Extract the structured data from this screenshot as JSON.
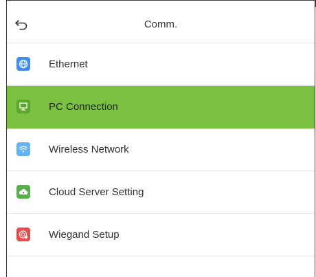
{
  "header": {
    "title": "Comm.",
    "back_icon": "back-arrow-icon"
  },
  "menu": {
    "items": [
      {
        "label": "Ethernet",
        "icon": "globe-icon",
        "icon_color": "#3d8ef0",
        "active": false
      },
      {
        "label": "PC Connection",
        "icon": "monitor-icon",
        "icon_color": "#5aa72c",
        "active": true
      },
      {
        "label": "Wireless Network",
        "icon": "wifi-icon",
        "icon_color": "#63b3f5",
        "active": false
      },
      {
        "label": "Cloud Server Setting",
        "icon": "cloud-icon",
        "icon_color": "#58b04a",
        "active": false
      },
      {
        "label": "Wiegand Setup",
        "icon": "wiegand-icon",
        "icon_color": "#e94b4b",
        "active": false
      }
    ]
  },
  "colors": {
    "active_row": "#7ac142"
  }
}
